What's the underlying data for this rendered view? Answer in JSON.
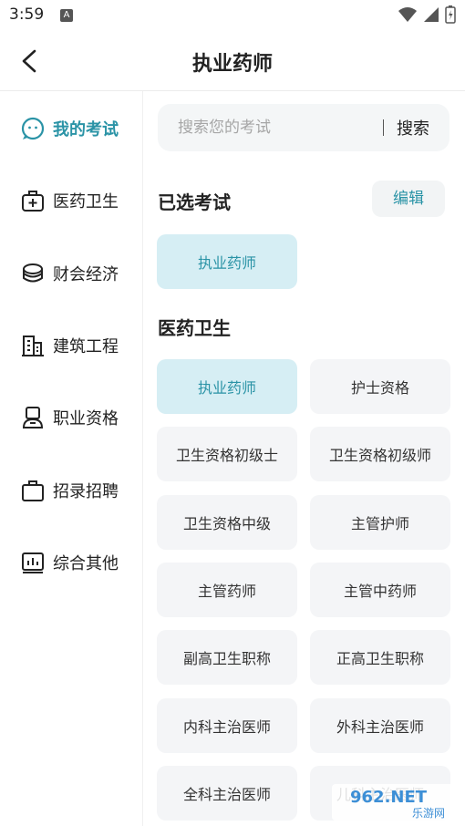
{
  "status_bar": {
    "time": "3:59",
    "notif_letter": "A"
  },
  "header": {
    "title": "执业药师"
  },
  "sidebar": {
    "items": [
      {
        "label": "我的考试",
        "icon": "smiley-chat-icon",
        "active": true
      },
      {
        "label": "医药卫生",
        "icon": "medical-kit-icon"
      },
      {
        "label": "财会经济",
        "icon": "coin-stack-icon"
      },
      {
        "label": "建筑工程",
        "icon": "building-icon"
      },
      {
        "label": "职业资格",
        "icon": "user-badge-icon"
      },
      {
        "label": "招录招聘",
        "icon": "briefcase-icon"
      },
      {
        "label": "综合其他",
        "icon": "bar-chart-icon"
      }
    ]
  },
  "search": {
    "placeholder": "搜索您的考试",
    "button_label": "搜索"
  },
  "selected_section": {
    "title": "已选考试",
    "edit_label": "编辑",
    "items": [
      "执业药师"
    ]
  },
  "category_section": {
    "title": "医药卫生",
    "items": [
      "执业药师",
      "护士资格",
      "卫生资格初级士",
      "卫生资格初级师",
      "卫生资格中级",
      "主管护师",
      "主管药师",
      "主管中药师",
      "副高卫生职称",
      "正高卫生职称",
      "内科主治医师",
      "外科主治医师",
      "全科主治医师",
      "儿科主治医师"
    ]
  },
  "watermark": {
    "text": "962.NET",
    "subtext": "乐游网"
  },
  "colors": {
    "accent": "#2a93a6",
    "chip_bg": "#f4f5f7",
    "chip_selected_bg": "#d6eef4"
  }
}
